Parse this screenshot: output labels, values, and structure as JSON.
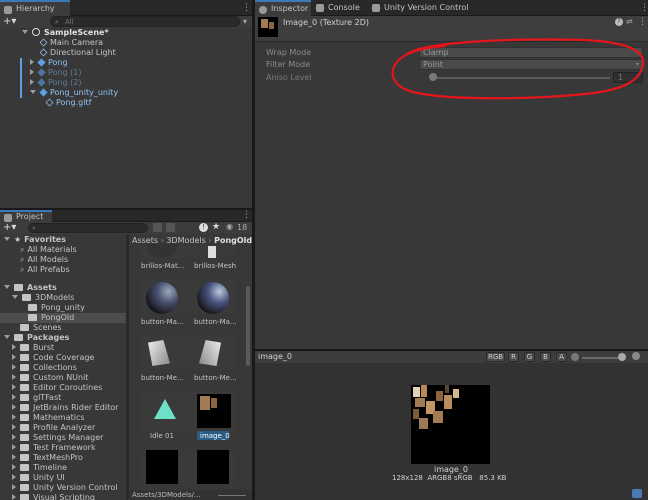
{
  "hierarchy": {
    "tab_label": "Hierarchy",
    "search_placeholder": "All",
    "scene_name": "SampleScene*",
    "items": [
      {
        "label": "Main Camera"
      },
      {
        "label": "Directional Light"
      },
      {
        "label": "Pong"
      },
      {
        "label": "Pong (1)"
      },
      {
        "label": "Pong (2)"
      },
      {
        "label": "Pong_unity_unity"
      },
      {
        "label": "Pong.gltf"
      }
    ]
  },
  "inspector": {
    "tabs": [
      {
        "label": "Inspector"
      },
      {
        "label": "Console"
      },
      {
        "label": "Unity Version Control"
      }
    ],
    "asset_title": "Image_0 (Texture 2D)",
    "wrap_mode_label": "Wrap Mode",
    "wrap_mode_value": "Clamp",
    "filter_mode_label": "Filter Mode",
    "filter_mode_value": "Point",
    "aniso_label": "Aniso Level",
    "aniso_value": "1",
    "annotation_color": "#e4161b"
  },
  "project": {
    "tab_label": "Project",
    "hidden_count": "18",
    "breadcrumb": [
      "Assets",
      "3DModels",
      "PongOld"
    ],
    "favorites_label": "Favorites",
    "favorites": [
      "All Materials",
      "All Models",
      "All Prefabs"
    ],
    "assets_label": "Assets",
    "models_folder": "3DModels",
    "models_children": [
      "Pong_unity",
      "PongOld"
    ],
    "scenes_folder": "Scenes",
    "packages_label": "Packages",
    "packages": [
      "Burst",
      "Code Coverage",
      "Collections",
      "Custom NUnit",
      "Editor Coroutines",
      "glTFast",
      "JetBrains Rider Editor",
      "Mathematics",
      "Profile Analyzer",
      "Settings Manager",
      "Test Framework",
      "TextMeshPro",
      "Timeline",
      "Unity UI",
      "Unity Version Control",
      "Visual Scripting"
    ],
    "grid_captions": {
      "row1": [
        "brillos-Mat...",
        "brillos-Mesh"
      ],
      "row2": [
        "button-Ma...",
        "button-Ma..."
      ],
      "row3": [
        "button-Me...",
        "button-Me..."
      ],
      "row4": [
        "Idle 01",
        "image_0"
      ]
    },
    "status_path": "Assets/3DModels/..."
  },
  "preview": {
    "name": "image_0",
    "channels": [
      "RGB",
      "R",
      "G",
      "B",
      "A"
    ],
    "image_label": "image_0",
    "image_info": "128x128  ARGB8 sRGB   85.3 KB"
  }
}
